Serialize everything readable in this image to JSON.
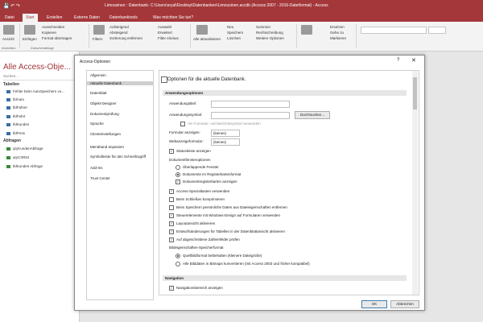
{
  "window": {
    "title": "Limousinen : Datenbank- C:\\Users\\sryal\\Desktop\\Datenbanken\\Limousinen.accdb (Access 2007 - 2016-Dateiformat) - Access"
  },
  "tabs": [
    {
      "label": "Datei"
    },
    {
      "label": "Start"
    },
    {
      "label": "Erstellen"
    },
    {
      "label": "Externe Daten"
    },
    {
      "label": "Datenbanktools"
    },
    {
      "label": "Was möchten Sie tun?"
    }
  ],
  "ribbon": {
    "ansicht": "Ansicht",
    "einfuegen": "Einfügen",
    "ausschneiden": "Ausschneiden",
    "kopieren": "Kopieren",
    "format": "Format übertragen",
    "filtern": "Filtern",
    "aufsteigend": "Aufsteigend",
    "absteigend": "Absteigend",
    "sortierung_entfernen": "Sortierung entfernen",
    "auswahl": "Auswahl",
    "erweitert": "Erweitert",
    "filter_ein_aus": "Filter ein/aus",
    "alle_aktualisieren": "Alle aktualisieren",
    "neu": "Neu",
    "speichern": "Speichern",
    "loeschen": "Löschen",
    "summen": "Summen",
    "rechtschreibung": "Rechtschreibung",
    "weitere": "Weitere Optionen",
    "suchen": "Suchen",
    "ersetzen": "Ersetzen",
    "gehe_zu": "Gehe zu",
    "markieren": "Markieren",
    "group_ansichten": "Ansichten",
    "group_zwischenablage": "Zwischenablage"
  },
  "navpane": {
    "title": "Alle Access-Obje...",
    "search_placeholder": "Suchen...",
    "group_tabellen": "Tabellen",
    "tabellen": [
      "Fehler beim AutoSpeichern vo...",
      "tblAuto",
      "tblFahrer",
      "tblFahrt",
      "tblKunden",
      "tblPreis"
    ],
    "group_abfragen": "Abfragen",
    "abfragen": [
      "qryKundenAbfrage",
      "qryCrtRk2",
      "tblKunden Abfrage"
    ]
  },
  "dialog": {
    "title": "Access-Optionen",
    "help": "?",
    "close": "✕",
    "categories": [
      "Allgemein",
      "Aktuelle Datenbank",
      "Datenblatt",
      "Objekt-Designer",
      "Dokumentprüfung",
      "Sprache",
      "Clienteinstellungen",
      "Menüband anpassen",
      "Symbolleiste für den Schnellzugriff",
      "Add-Ins",
      "Trust Center"
    ],
    "heading": "Optionen für die aktuelle Datenbank.",
    "sec_app": "Anwendungsoptionen",
    "anwendungstitel": "Anwendungstitel:",
    "anwendungssymbol": "Anwendungssymbol:",
    "durchsuchen": "Durchsuchen...",
    "als_symbol": "Als Formular- und Berichtssymbol verwenden",
    "formular_anzeigen": "Formular anzeigen:",
    "formular_value": "(keines)",
    "webanzeige": "Webanzeigeformular:",
    "webanzeige_value": "(keines)",
    "statusleiste": "Statusleiste anzeigen",
    "dokfenster": "Dokumentfensteroptionen",
    "ueberlappend": "Überlappende Fenster",
    "registerkarten": "Dokumente im Registerkartenformat",
    "dokregister": "Dokumentregisterkarten anzeigen",
    "tasten": "Access-Spezialtasten verwenden",
    "schliessen": "Beim Schließen komprimieren",
    "persoenliche": "Beim Speichern persönliche Daten aus Dateieigenschaften entfernen",
    "windows_design": "Steuerelemente mit Windows-Design auf Formularen verwenden",
    "layoutansicht": "Layoutansicht aktivieren",
    "entwurf": "Entwurfsänderungen für Tabellen in der Datenblattansicht aktivieren",
    "zahlenfelder": "Auf abgeschnittene Zahlenfelder prüfen",
    "bildformat": "Bildeigenschaften-Speicherformat",
    "quellbild": "Quellbildformat beibehalten (kleinere Dateigröße)",
    "bitmaps": "Alle Bilddaten in Bitmaps konvertieren (mit Access 2003 und früher kompatibel)",
    "sec_nav": "Navigation",
    "navbereich": "Navigationsbereich anzeigen",
    "ok": "OK",
    "abbrechen": "Abbrechen"
  }
}
